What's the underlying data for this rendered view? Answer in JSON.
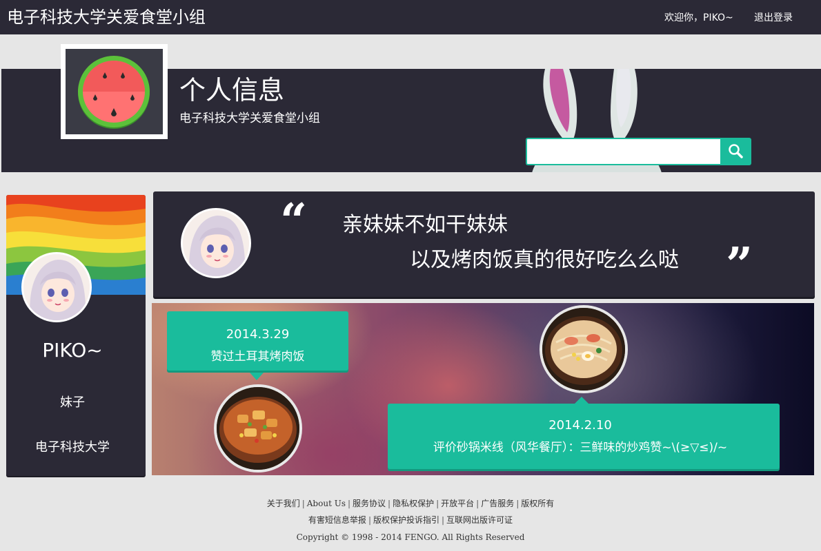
{
  "nav": {
    "brand": "电子科技大学关爱食堂小组",
    "welcome": "欢迎你，PIKO~",
    "logout": "退出登录"
  },
  "header": {
    "title": "个人信息",
    "subtitle": "电子科技大学关爱食堂小组",
    "search_value": ""
  },
  "icons": {
    "logo": "watermelon-icon",
    "search": "search-icon"
  },
  "colors": {
    "dark": "#2b2936",
    "accent": "#1abc9c",
    "background": "#e6e6e6"
  },
  "profile": {
    "name": "PIKO~",
    "gender": "妹子",
    "school": "电子科技大学"
  },
  "quote": {
    "open_mark": "“",
    "line1": "亲妹妹不如干妹妹",
    "line2": "以及烤肉饭真的很好吃么么哒",
    "close_mark": "”"
  },
  "timeline": [
    {
      "date": "2014.3.29",
      "text": "赞过土耳其烤肉饭"
    },
    {
      "date": "2014.2.10",
      "text": "评价砂锅米线（风华餐厅）：三鲜味的炒鸡赞~\\(≥▽≤)/~"
    }
  ],
  "footer": {
    "links_row1": [
      "关于我们",
      "About Us",
      "服务协议",
      "隐私权保护",
      "开放平台",
      "广告服务",
      "版权所有"
    ],
    "links_row2": [
      "有害短信息举报",
      "版权保护投诉指引",
      "互联网出版许可证"
    ],
    "copyright": "Copyright © 1998 - 2014 FENGO. All Rights Reserved"
  }
}
